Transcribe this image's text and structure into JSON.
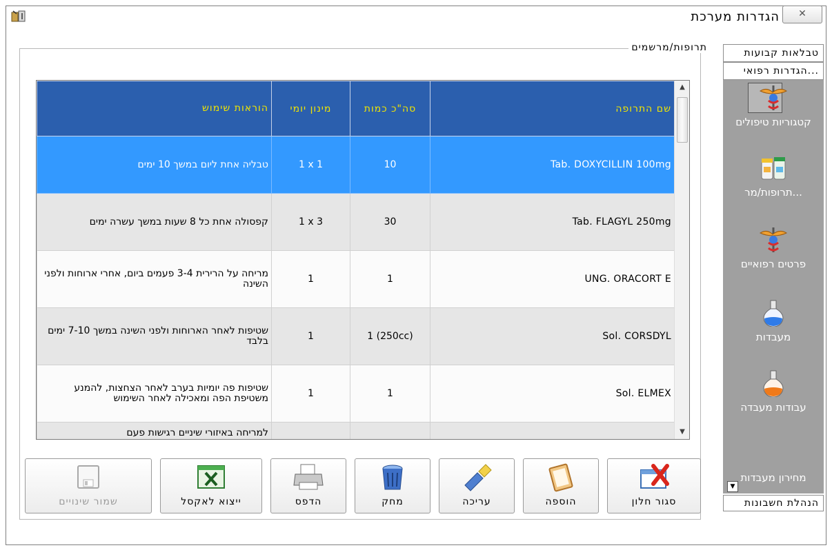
{
  "window": {
    "title": "הגדרות מערכת",
    "close_label": "✕"
  },
  "group": {
    "legend": "תרופות/מרשמים"
  },
  "table": {
    "headers": {
      "name": "שם התרופה",
      "qty": "סה\"כ כמות",
      "dose": "מינון יומי",
      "instructions": "הוראות שימוש"
    },
    "rows": [
      {
        "name": "Tab. DOXYCILLIN  100mg",
        "qty": "10",
        "dose": "1 x 1",
        "instructions": "טבליה אחת ליום במשך 10 ימים",
        "selected": true
      },
      {
        "name": "Tab. FLAGYL  250mg",
        "qty": "30",
        "dose": "1 x 3",
        "instructions": "קפסולה אחת כל 8 שעות במשך עשרה ימים"
      },
      {
        "name": "UNG. ORACORT  E",
        "qty": "1",
        "dose": "1",
        "instructions": "מריחה על הרירית 3-4 פעמים ביום, אחרי ארוחות ולפני השינה"
      },
      {
        "name": "Sol. CORSDYL",
        "qty": "1 (250cc)",
        "dose": "1",
        "instructions": "שטיפות לאחר הארוחות ולפני השינה במשך 7-10 ימים בלבד"
      },
      {
        "name": "Sol. ELMEX",
        "qty": "1",
        "dose": "1",
        "instructions": "שטיפות פה יומיות בערב לאחר הצחצות, להמנע משטיפת הפה ומאכילה לאחר השימוש"
      },
      {
        "name": "",
        "qty": "",
        "dose": "",
        "instructions": "למריחה באיזורי שיניים רגישות פעם"
      }
    ]
  },
  "buttons": {
    "close": "סגור חלון",
    "add": "הוספה",
    "edit": "עריכה",
    "delete": "מחק",
    "print": "הדפס",
    "excel": "ייצוא לאקסל",
    "save": "שמור שינויים"
  },
  "nav": {
    "tab_fixed": "טבלאות קבועות",
    "tab_medical": "...הגדרות רפואי",
    "items": [
      {
        "label": "קטגוריות טיפולים",
        "icon": "caduceus-icon"
      },
      {
        "label": "...תרופות/מר",
        "icon": "pill-bottles-icon"
      },
      {
        "label": "פרטים רפואיים",
        "icon": "caduceus-icon"
      },
      {
        "label": "מעבדות",
        "icon": "flask-blue-icon"
      },
      {
        "label": "עבודות מעבדה",
        "icon": "flask-orange-icon"
      },
      {
        "label": "מחירון מעבדות",
        "icon": "none"
      }
    ],
    "bottom_tab": "הנהלת חשבונות"
  },
  "colors": {
    "header_bg": "#2b5fae",
    "header_text": "#f2e600",
    "selected_row": "#3399ff",
    "nav_bg": "#a0a0a0"
  }
}
